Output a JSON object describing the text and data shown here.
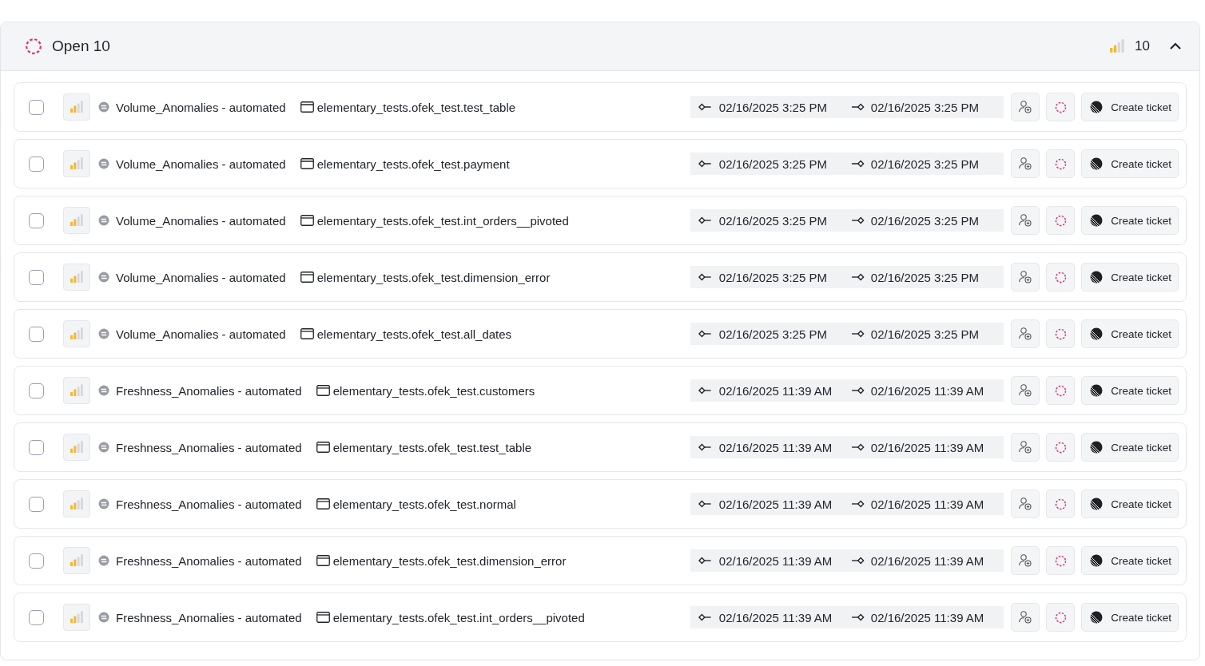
{
  "header": {
    "title": "Open 10",
    "level": 0.5,
    "count": "10",
    "expanded": true
  },
  "rows": [
    {
      "checked": false,
      "level": 0.5,
      "name": "Volume_Anomalies - automated",
      "table": "elementary_tests.ofek_test.test_table",
      "start": "02/16/2025 3:25 PM",
      "end": "02/16/2025 3:25 PM",
      "action": "Create ticket"
    },
    {
      "checked": false,
      "level": 0.5,
      "name": "Volume_Anomalies - automated",
      "table": "elementary_tests.ofek_test.payment",
      "start": "02/16/2025 3:25 PM",
      "end": "02/16/2025 3:25 PM",
      "action": "Create ticket"
    },
    {
      "checked": false,
      "level": 0.5,
      "name": "Volume_Anomalies - automated",
      "table": "elementary_tests.ofek_test.int_orders__pivoted",
      "start": "02/16/2025 3:25 PM",
      "end": "02/16/2025 3:25 PM",
      "action": "Create ticket"
    },
    {
      "checked": false,
      "level": 0.5,
      "name": "Volume_Anomalies - automated",
      "table": "elementary_tests.ofek_test.dimension_error",
      "start": "02/16/2025 3:25 PM",
      "end": "02/16/2025 3:25 PM",
      "action": "Create ticket"
    },
    {
      "checked": false,
      "level": 0.5,
      "name": "Volume_Anomalies - automated",
      "table": "elementary_tests.ofek_test.all_dates",
      "start": "02/16/2025 3:25 PM",
      "end": "02/16/2025 3:25 PM",
      "action": "Create ticket"
    },
    {
      "checked": false,
      "level": 0.5,
      "name": "Freshness_Anomalies - automated",
      "table": "elementary_tests.ofek_test.customers",
      "start": "02/16/2025 11:39 AM",
      "end": "02/16/2025 11:39 AM",
      "action": "Create ticket"
    },
    {
      "checked": false,
      "level": 0.5,
      "name": "Freshness_Anomalies - automated",
      "table": "elementary_tests.ofek_test.test_table",
      "start": "02/16/2025 11:39 AM",
      "end": "02/16/2025 11:39 AM",
      "action": "Create ticket"
    },
    {
      "checked": false,
      "level": 0.5,
      "name": "Freshness_Anomalies - automated",
      "table": "elementary_tests.ofek_test.normal",
      "start": "02/16/2025 11:39 AM",
      "end": "02/16/2025 11:39 AM",
      "action": "Create ticket"
    },
    {
      "checked": false,
      "level": 0.5,
      "name": "Freshness_Anomalies - automated",
      "table": "elementary_tests.ofek_test.dimension_error",
      "start": "02/16/2025 11:39 AM",
      "end": "02/16/2025 11:39 AM",
      "action": "Create ticket"
    },
    {
      "checked": false,
      "level": 0.5,
      "name": "Freshness_Anomalies - automated",
      "table": "elementary_tests.ofek_test.int_orders__pivoted",
      "start": "02/16/2025 11:39 AM",
      "end": "02/16/2025 11:39 AM",
      "action": "Create ticket"
    }
  ]
}
